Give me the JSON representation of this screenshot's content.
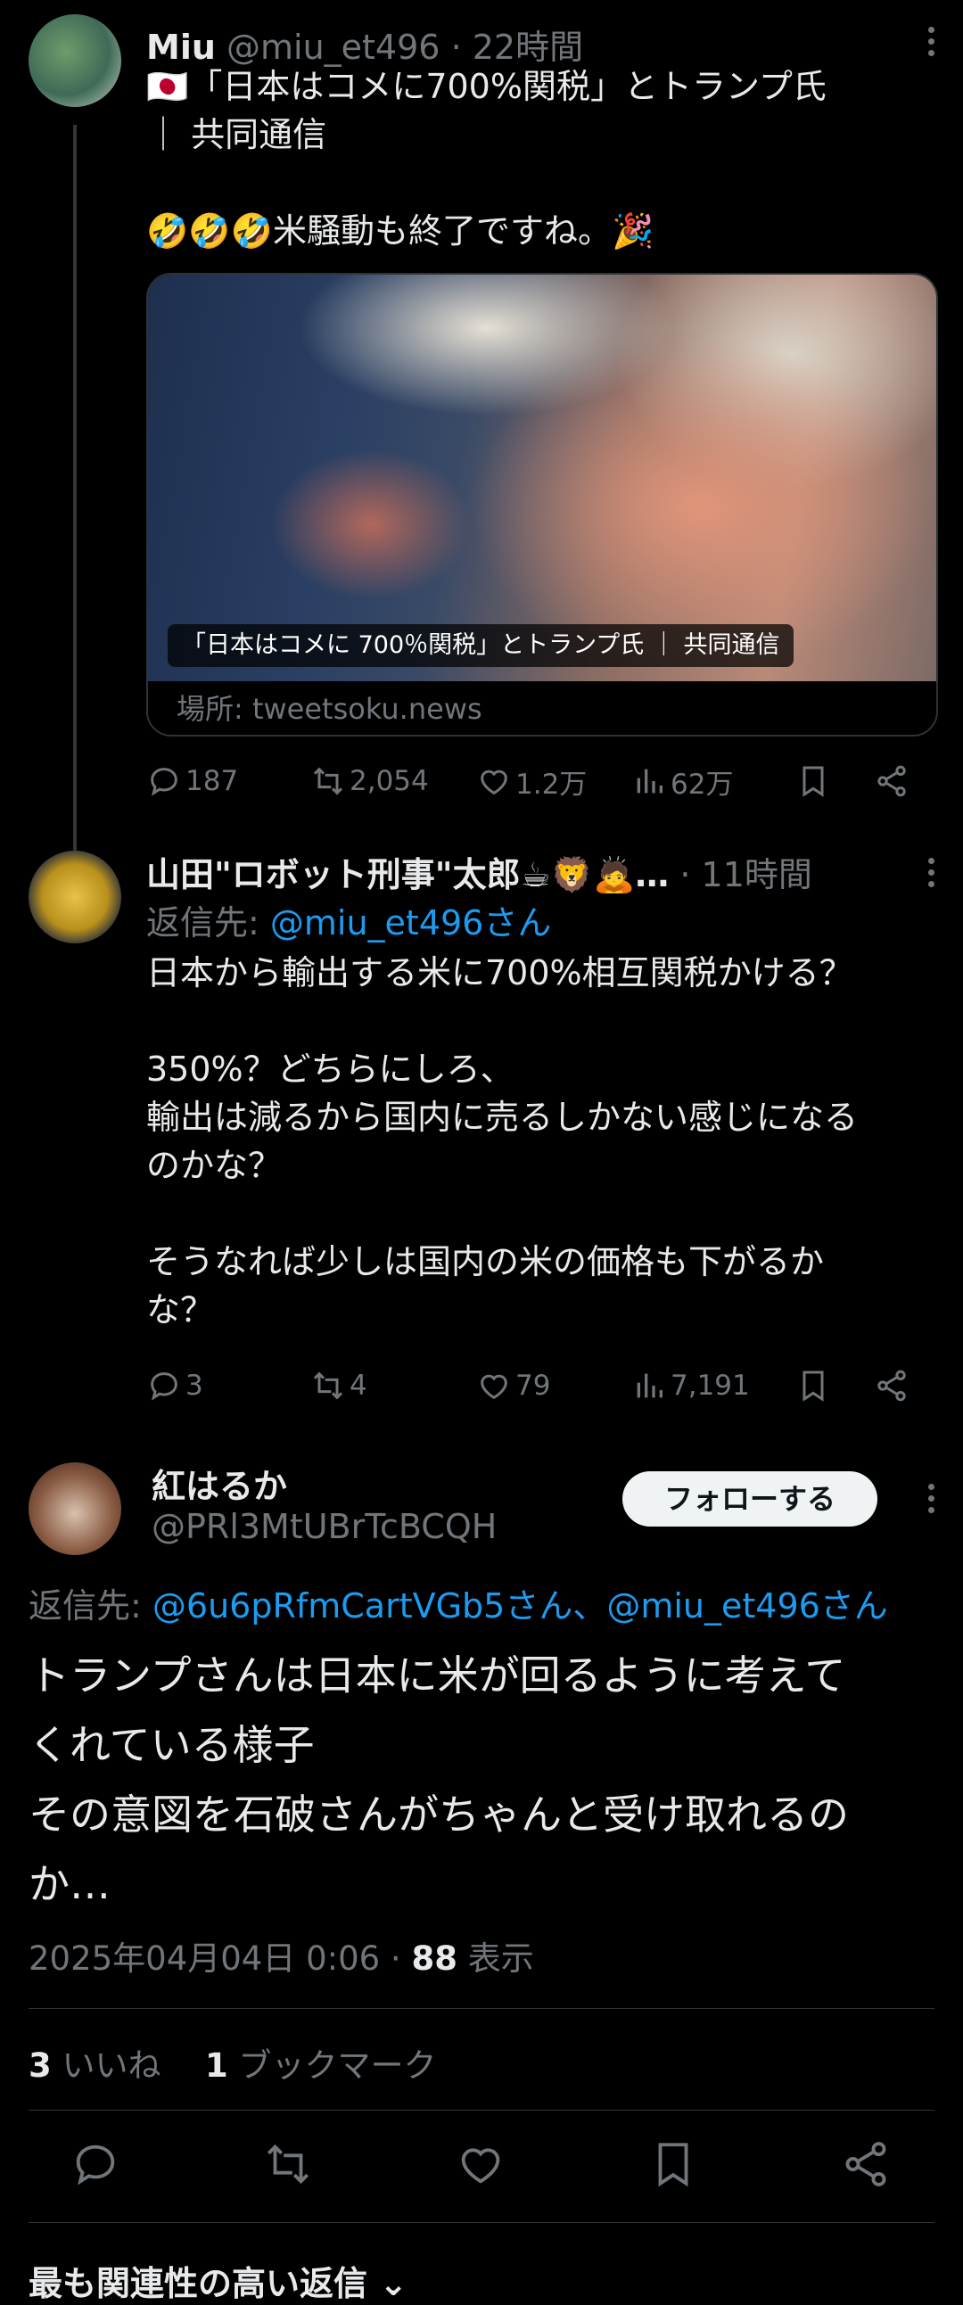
{
  "tweet1": {
    "display_name": "Miu",
    "handle": "@miu_et496",
    "time": "· 22時間",
    "text": "🇯🇵「日本はコメに700%関税」とトランプ氏\n｜ 共同通信\n\n🤣🤣🤣米騒動も終了ですね。🎉",
    "card_caption": "「日本はコメに 700％関税」とトランプ氏 ｜ 共同通信",
    "card_source": "場所: tweetsoku.news",
    "replies": "187",
    "retweets": "2,054",
    "likes": "1.2万",
    "views": "62万"
  },
  "tweet2": {
    "display_name": "山田\"ロボット刑事\"太郎☕🦁🙇…",
    "time": "· 11時間",
    "reply_prefix": "返信先: ",
    "reply_to": "@miu_et496さん",
    "text": "日本から輸出する米に700%相互関税かける？\n\n350%？どちらにしろ、\n輸出は減るから国内に売るしかない感じになる\nのかな？\n\nそうなれば少しは国内の米の価格も下がるか\nな？",
    "replies": "3",
    "retweets": "4",
    "likes": "79",
    "views": "7,191"
  },
  "tweet3": {
    "display_name": "紅はるか",
    "handle": "@PRl3MtUBrTcBCQH",
    "follow_label": "フォローする",
    "reply_prefix": "返信先: ",
    "reply_to": "@6u6pRfmCartVGb5さん、@miu_et496さん",
    "text": "トランプさんは日本に米が回るように考えて\nくれている様子\nその意図を石破さんがちゃんと受け取れるの\nか…",
    "timestamp": "2025年04月04日 0:06 · ",
    "view_count": "88",
    "view_label": " 表示",
    "likes_count": "3",
    "likes_label": " いいね",
    "bookmarks_count": "1",
    "bookmarks_label": " ブックマーク"
  },
  "replies_sort_label": "最も関連性の高い返信 ⌄",
  "colors": {
    "background": "#000000",
    "text": "#e7e9ea",
    "secondary": "#71767b",
    "link": "#1d9bf0"
  }
}
